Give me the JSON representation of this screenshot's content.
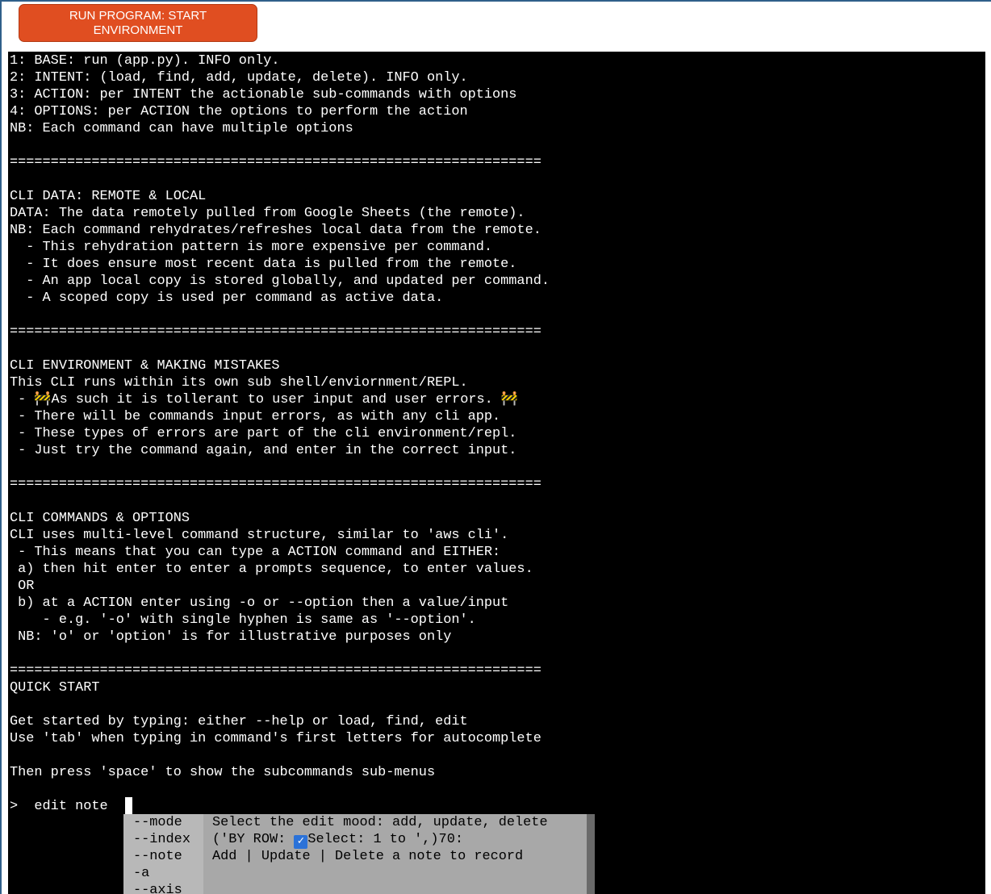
{
  "run_button": {
    "label": "RUN PROGRAM: START ENVIRONMENT"
  },
  "terminal": {
    "output": "1: BASE: run (app.py). INFO only.\n2: INTENT: (load, find, add, update, delete). INFO only.\n3: ACTION: per INTENT the actionable sub-commands with options\n4: OPTIONS: per ACTION the options to perform the action\nNB: Each command can have multiple options\n\n=================================================================\n\nCLI DATA: REMOTE & LOCAL\nDATA: The data remotely pulled from Google Sheets (the remote).\nNB: Each command rehydrates/refreshes local data from the remote.\n  - This rehydration pattern is more expensive per command.\n  - It does ensure most recent data is pulled from the remote.\n  - An app local copy is stored globally, and updated per command.\n  - A scoped copy is used per command as active data.\n\n=================================================================\n\nCLI ENVIRONMENT & MAKING MISTAKES\nThis CLI runs within its own sub shell/enviornment/REPL.\n - 🚧As such it is tollerant to user input and user errors. 🚧\n - There will be commands input errors, as with any cli app.\n - These types of errors are part of the cli environment/repl.\n - Just try the command again, and enter in the correct input.\n\n=================================================================\n\nCLI COMMANDS & OPTIONS\nCLI uses multi-level command structure, similar to 'aws cli'.\n - This means that you can type a ACTION command and EITHER:\n a) then hit enter to enter a prompts sequence, to enter values.\n OR\n b) at a ACTION enter using -o or --option then a value/input\n    - e.g. '-o' with single hyphen is same as '--option'.\n NB: 'o' or 'option' is for illustrative purposes only\n\n=================================================================\nQUICK START\n\nGet started by typing: either --help or load, find, edit\nUse 'tab' when typing in command's first letters for autocomplete\n\nThen press 'space' to show the subcommands sub-menus",
    "prompt": ">  edit note "
  },
  "completion_menu": {
    "options": [
      "--mode",
      "--index",
      "--note",
      "-a",
      "--axis"
    ],
    "meta_mode": "Select the edit mood: add, update, delete",
    "meta_index_prefix": "('BY ROW: ",
    "meta_index_check": "✓",
    "meta_index_suffix": "Select: 1 to ',)70:",
    "meta_note": "Add | Update | Delete a note to record"
  },
  "colors": {
    "button_bg": "#e04e21",
    "terminal_bg": "#000000",
    "terminal_fg": "#ffffff",
    "menu_bg": "#a8a8a8"
  },
  "icons": {
    "check": "checkmark-icon",
    "construction": "construction-sign-icon"
  }
}
